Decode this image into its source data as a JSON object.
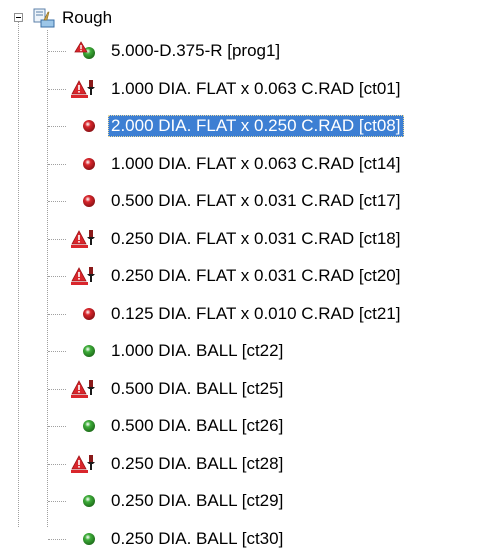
{
  "tree": {
    "root": {
      "label": "Rough",
      "icon": "machining-group-icon",
      "expanded": true
    },
    "items": [
      {
        "label": "5.000-D.375-R [prog1]",
        "icon": "program-warning-icon"
      },
      {
        "label": "1.000 DIA. FLAT x 0.063 C.RAD [ct01]",
        "icon": "cutter-warning-icon"
      },
      {
        "label": "2.000 DIA. FLAT x 0.250 C.RAD [ct08]",
        "icon": "red-ball-icon",
        "selected": true
      },
      {
        "label": "1.000 DIA. FLAT x 0.063 C.RAD [ct14]",
        "icon": "red-ball-icon"
      },
      {
        "label": "0.500 DIA. FLAT x 0.031 C.RAD [ct17]",
        "icon": "red-ball-icon"
      },
      {
        "label": "0.250 DIA. FLAT x 0.031 C.RAD [ct18]",
        "icon": "cutter-warning-icon"
      },
      {
        "label": "0.250 DIA. FLAT x 0.031 C.RAD [ct20]",
        "icon": "cutter-warning-icon"
      },
      {
        "label": "0.125 DIA. FLAT x 0.010 C.RAD [ct21]",
        "icon": "red-ball-icon"
      },
      {
        "label": "1.000 DIA. BALL [ct22]",
        "icon": "green-ball-icon"
      },
      {
        "label": "0.500 DIA. BALL [ct25]",
        "icon": "cutter-warning-icon"
      },
      {
        "label": "0.500 DIA. BALL [ct26]",
        "icon": "green-ball-icon"
      },
      {
        "label": "0.250 DIA. BALL [ct28]",
        "icon": "cutter-warning-icon"
      },
      {
        "label": "0.250 DIA. BALL [ct29]",
        "icon": "green-ball-icon"
      },
      {
        "label": "0.250 DIA. BALL [ct30]",
        "icon": "green-ball-icon"
      }
    ]
  },
  "colors": {
    "selection": "#3d7fd3",
    "status_red": "#d9262c",
    "status_green": "#3fae3a"
  }
}
